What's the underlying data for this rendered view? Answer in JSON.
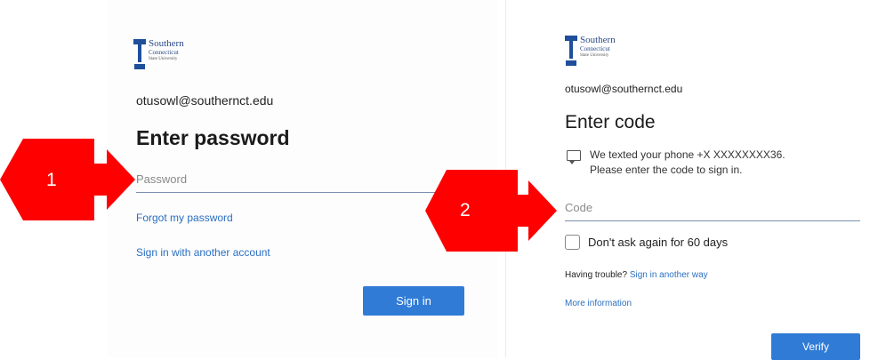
{
  "left": {
    "logo": {
      "line1": "Southern",
      "line2": "Connecticut",
      "line3": "State University"
    },
    "email": "otusowl@southernct.edu",
    "title": "Enter password",
    "password_placeholder": "Password",
    "forgot_link": "Forgot my password",
    "other_account_link": "Sign in with another account",
    "sign_in_button": "Sign in"
  },
  "right": {
    "logo": {
      "line1": "Southern",
      "line2": "Connecticut",
      "line3": "State University"
    },
    "email": "otusowl@southernct.edu",
    "title": "Enter code",
    "message_line1": "We texted your phone +X XXXXXXXX36.",
    "message_line2": "Please enter the code to sign in.",
    "code_placeholder": "Code",
    "dont_ask_label": "Don't ask again for 60 days",
    "trouble_text": "Having trouble?",
    "sign_in_another_way": "Sign in another way",
    "more_info_link": "More information",
    "verify_button": "Verify"
  },
  "annotations": {
    "step1_label": "1",
    "step2_label": "2",
    "arrow_color": "#ff0000"
  },
  "colors": {
    "accent": "#2f7bd6",
    "link": "#2a6fc1",
    "brand": "#1f4e9a"
  }
}
